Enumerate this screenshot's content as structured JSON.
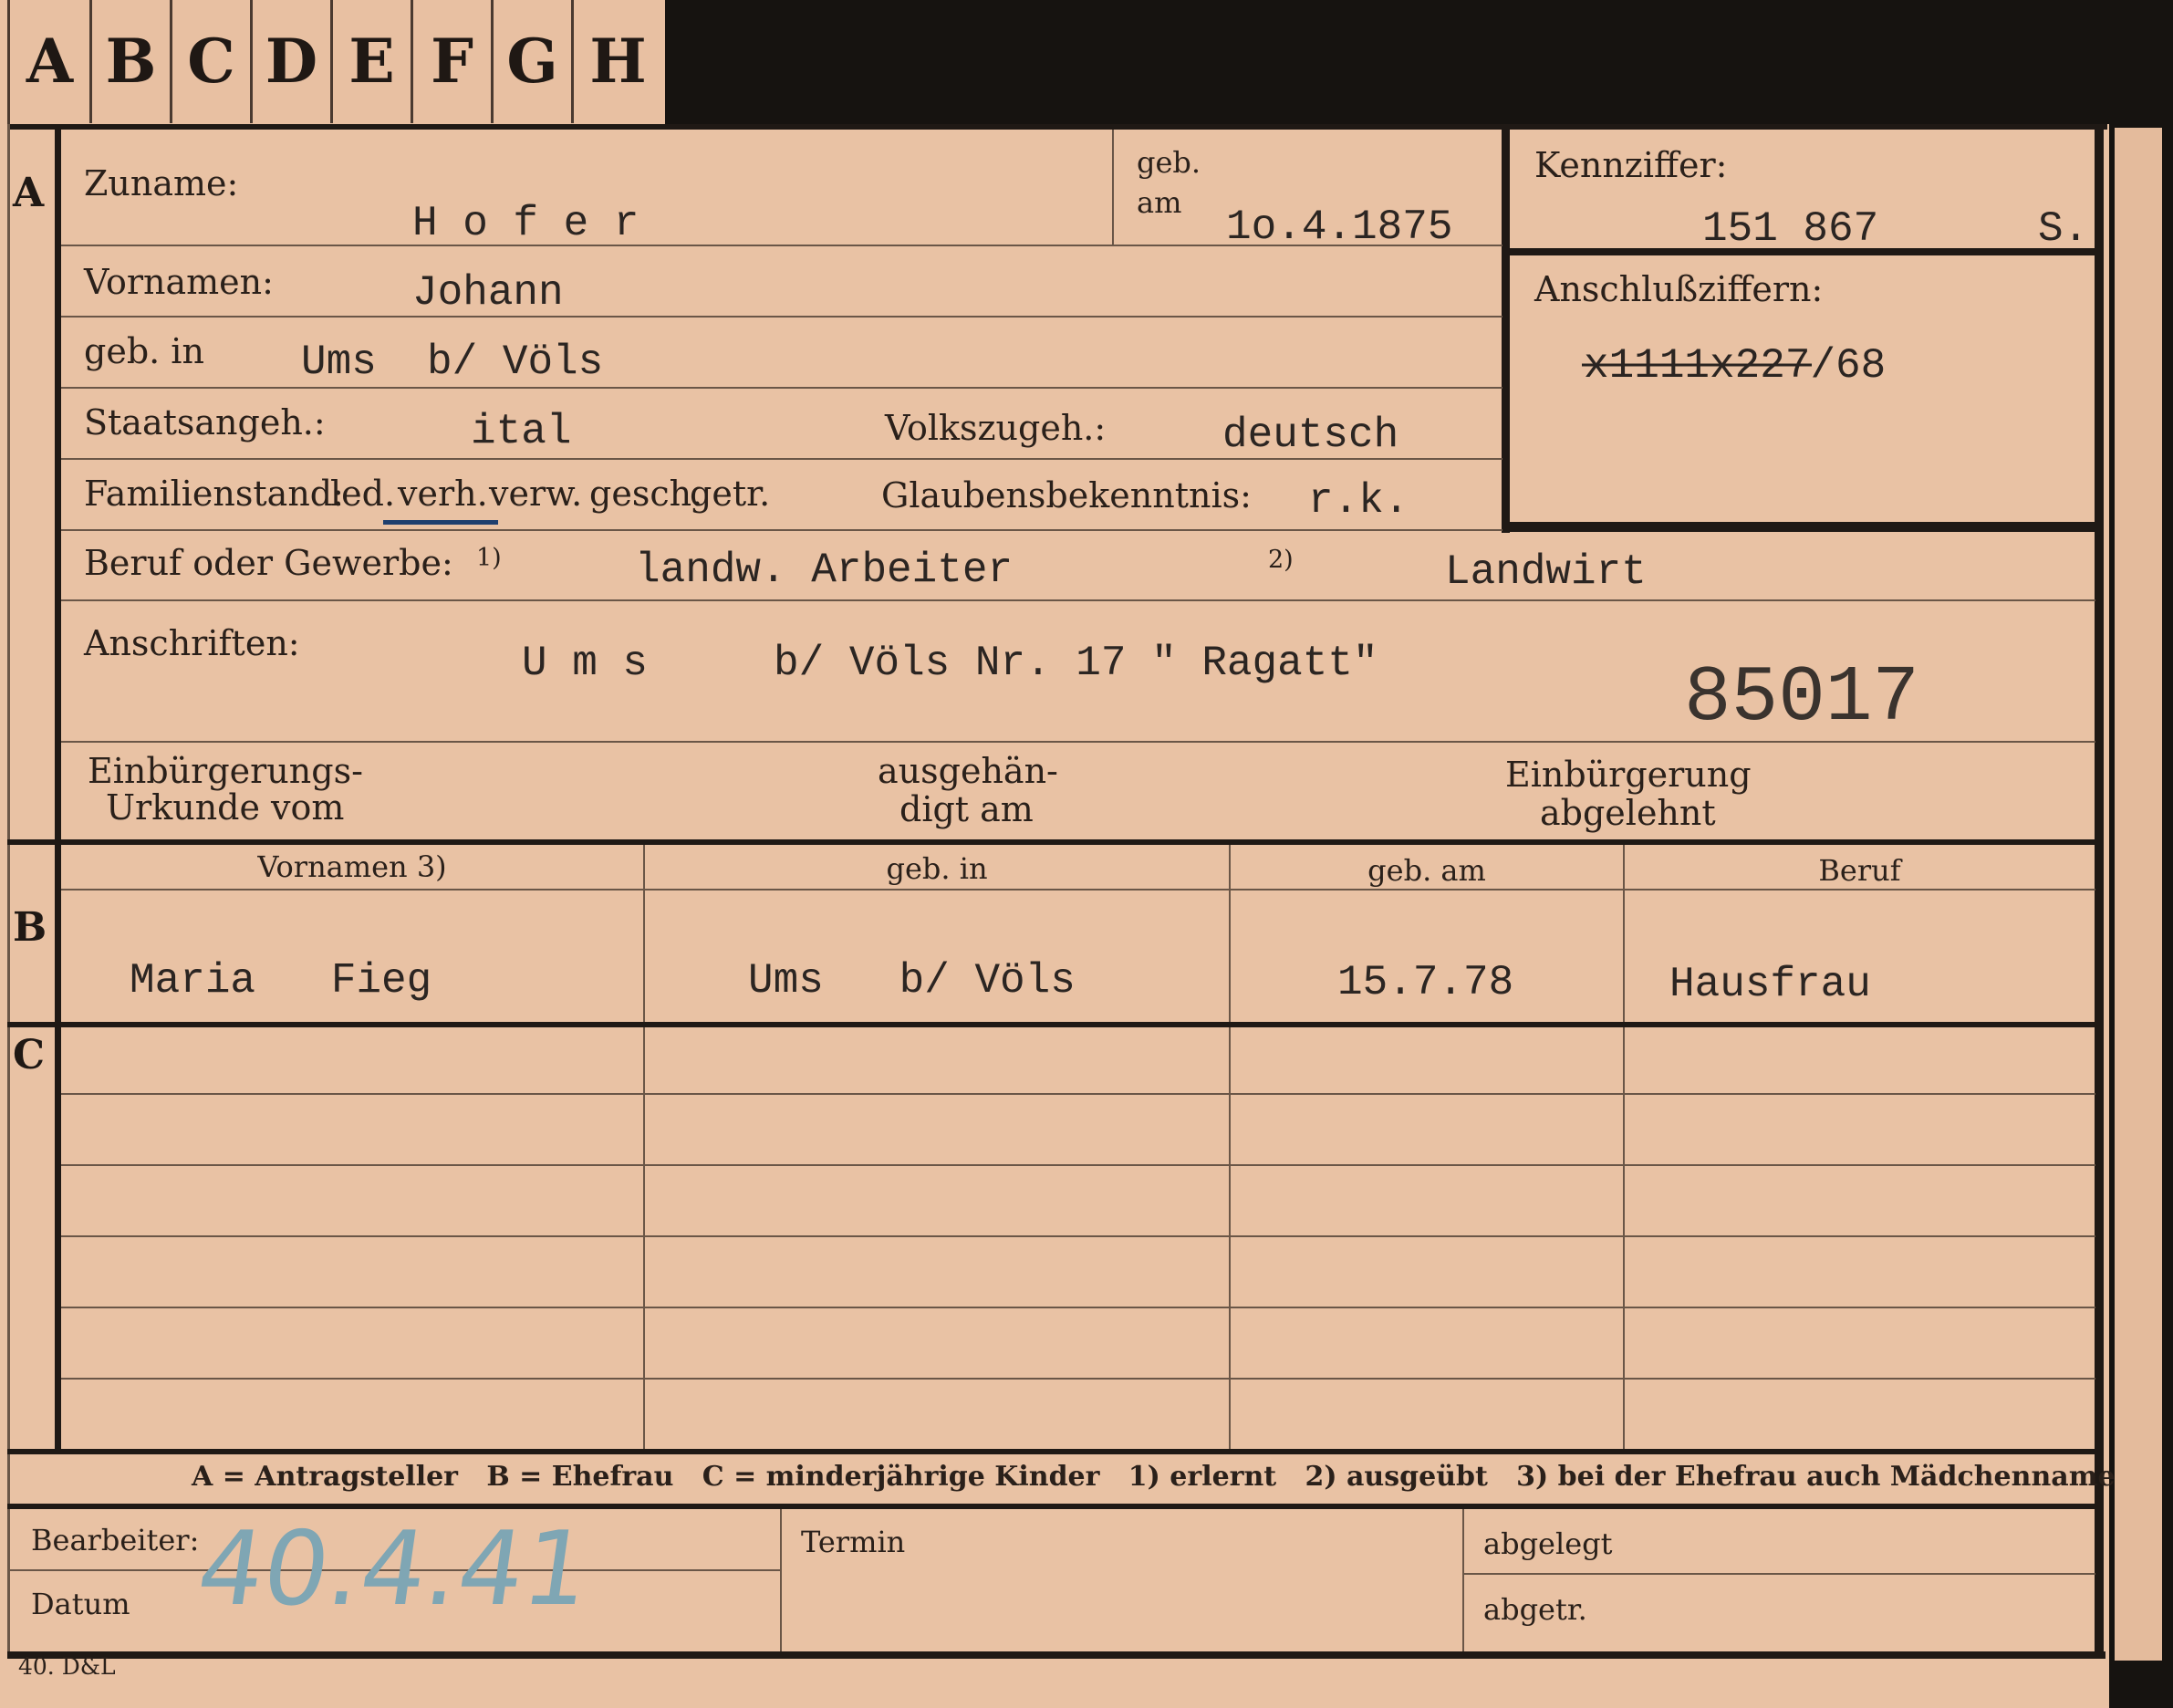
{
  "tabs": [
    "A",
    "B",
    "C",
    "D",
    "E",
    "F",
    "G",
    "H"
  ],
  "sections": {
    "a": "A",
    "b": "B",
    "c": "C"
  },
  "header": {
    "surname_label": "Zuname:",
    "surname_value": "H o f e r",
    "born_label_1": "geb.",
    "born_label_2": "am",
    "born_value": "1o.4.1875",
    "kennziffer_label": "Kennziffer:",
    "kennziffer_value": "151 867",
    "kennziffer_suffix": "S.",
    "anschluss_label": "Anschlußziffern:",
    "anschluss_value": "x1111x227/68"
  },
  "person": {
    "first_names_label": "Vornamen:",
    "first_names_value": "Johann",
    "birthplace_label": "geb. in",
    "birthplace_value": "Ums  b/ Völs",
    "citizenship_label": "Staatsangeh.:",
    "citizenship_value": "ital",
    "ethnicity_label": "Volkszugeh.:",
    "ethnicity_value": "deutsch",
    "family_status_label": "Familienstand:",
    "family_status_options": [
      "led.",
      "verh.",
      "verw.",
      "gesch.",
      "getr."
    ],
    "family_status_selected": "verh.",
    "religion_label": "Glaubensbekenntnis:",
    "religion_value": "r.k.",
    "profession_label": "Beruf oder Gewerbe:",
    "profession_marker_1": "1)",
    "profession_learned": "landw. Arbeiter",
    "profession_marker_2": "2)",
    "profession_practiced": "Landwirt",
    "address_label": "Anschriften:",
    "address_value": "U m s     b/ Völs Nr. 17 \" Ragatt\"",
    "stamp_number": "85017",
    "naturalization_label_1": "Einbürgerungs-",
    "naturalization_label_2": "Urkunde vom",
    "issued_label_1": "ausgehän-",
    "issued_label_2": "digt am",
    "refused_label_1": "Einbürgerung",
    "refused_label_2": "abgelehnt"
  },
  "table": {
    "headers": [
      "Vornamen 3)",
      "geb. in",
      "geb. am",
      "Beruf"
    ],
    "spouse": {
      "first_names": "Maria   Fieg",
      "birthplace": "Ums   b/ Völs",
      "birthdate": "15.7.78",
      "profession": "Hausfrau"
    }
  },
  "legend": "A = Antragsteller   B = Ehefrau   C = minderjährige Kinder   1) erlernt   2) ausgeübt   3) bei der Ehefrau auch Mädchenname",
  "footer": {
    "clerk_label": "Bearbeiter:",
    "date_label": "Datum",
    "date_value": "40.4.41",
    "deadline_label": "Termin",
    "filed_label": "abgelegt",
    "dispatched_label": "abgetr.",
    "print_code": "40. D&L"
  },
  "colors": {
    "card": "#e9c2a4",
    "ink": "#2b2522",
    "stamp_blue": "#7fa6b4"
  }
}
